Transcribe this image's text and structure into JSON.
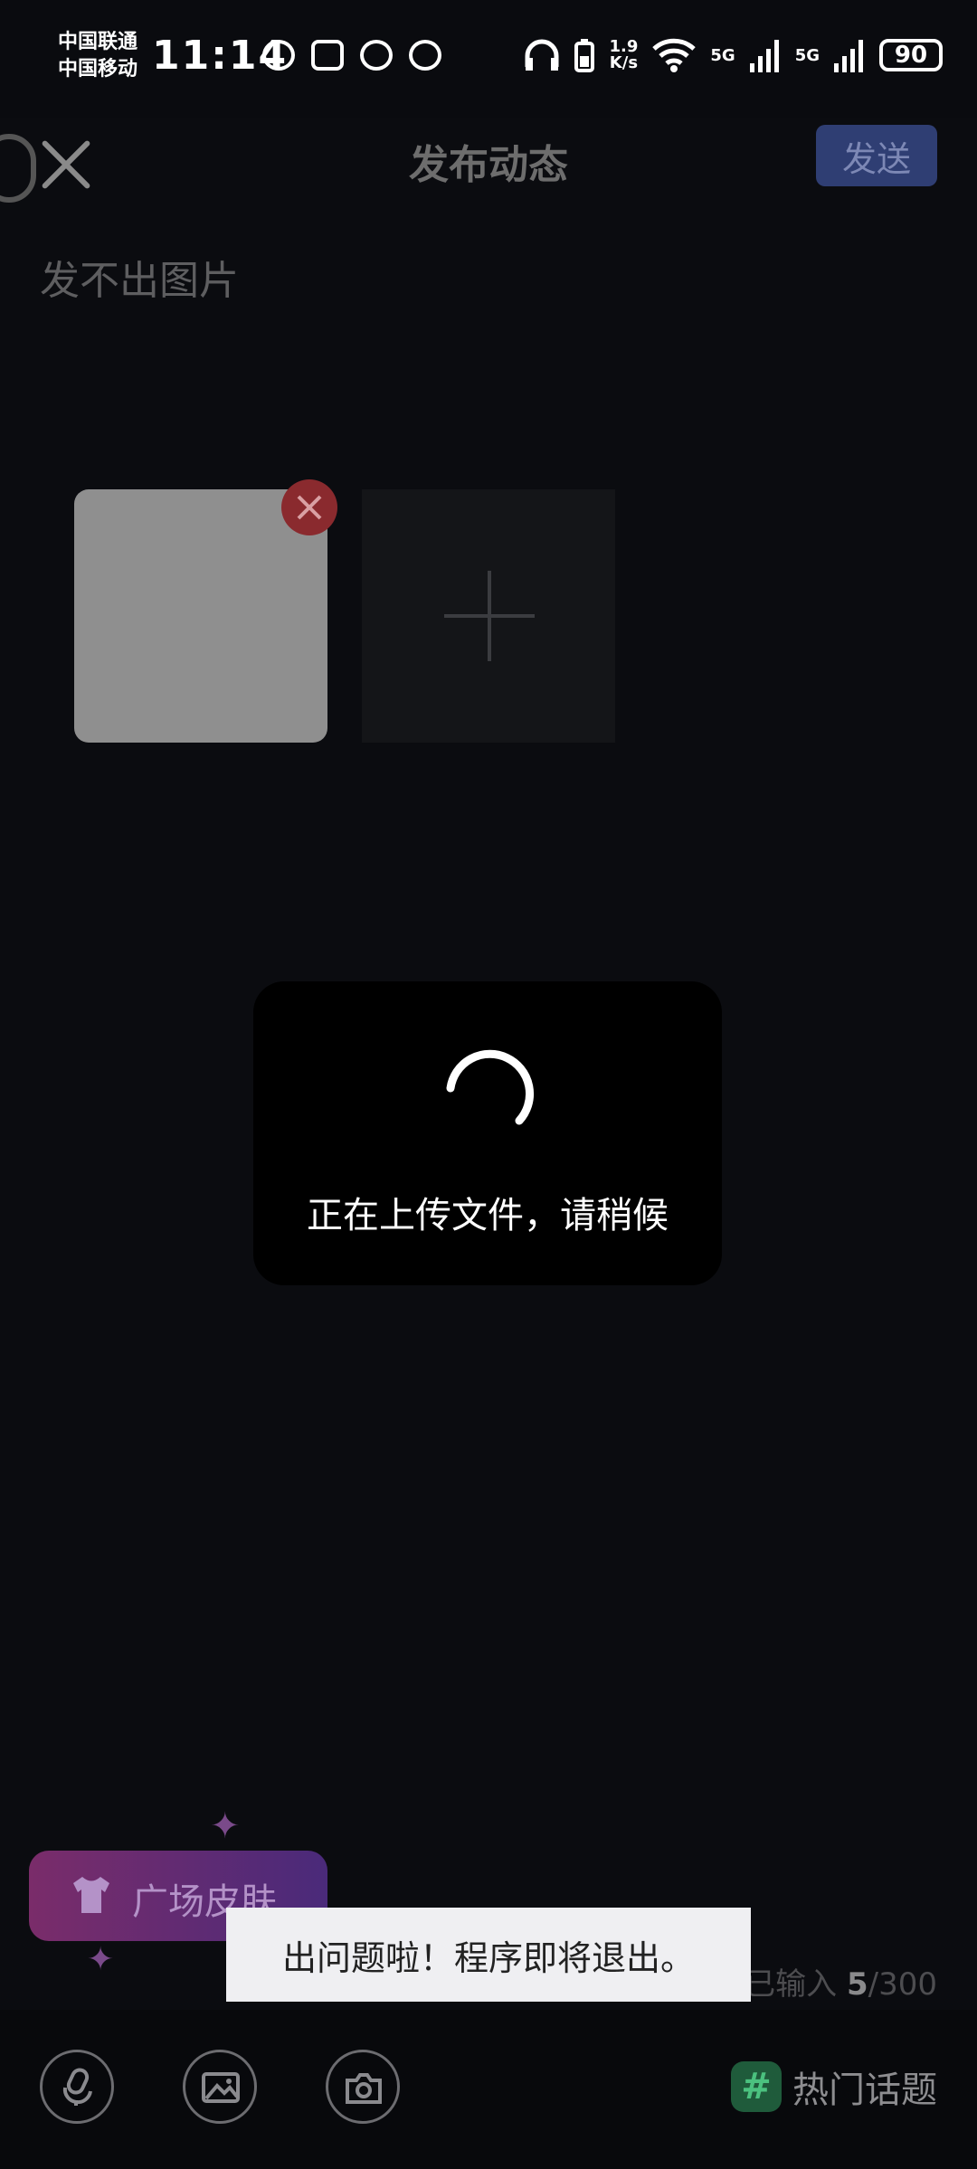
{
  "status_bar": {
    "carrier_1": "中国联通",
    "carrier_2": "中国移动",
    "time": "11:14",
    "net_speed": "1.9\nK/s",
    "signal_1": "5G",
    "signal_2": "5G",
    "battery": "90"
  },
  "header": {
    "title": "发布动态",
    "send_label": "发送"
  },
  "post": {
    "text": "发不出图片",
    "char_count": "5",
    "char_limit": "300",
    "count_prefix": "已输入 "
  },
  "loading": {
    "message": "正在上传文件，请稍候"
  },
  "skin_button": {
    "label": "广场皮肤"
  },
  "toast": {
    "message": "出问题啦！程序即将退出。"
  },
  "toolbar": {
    "hot_topics_label": "热门话题",
    "hash_symbol": "#"
  },
  "colors": {
    "send_button": "#2f3e73",
    "delete_badge": "#8a2a2e",
    "hot_hash": "#1f5b3b"
  },
  "icons": [
    "close-icon",
    "add-icon",
    "mic-icon",
    "image-icon",
    "camera-icon",
    "shirt-icon",
    "hash-icon"
  ]
}
